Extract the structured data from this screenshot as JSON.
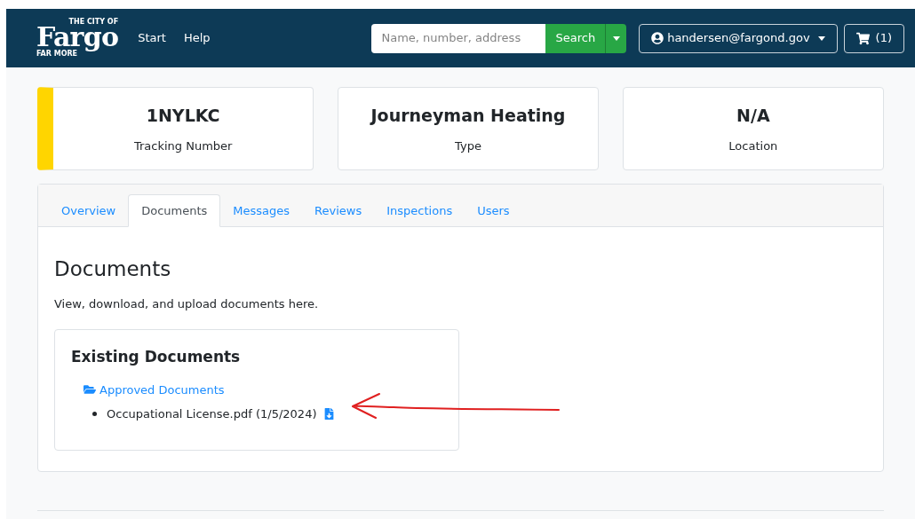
{
  "header": {
    "logo": {
      "top": "THE CITY OF",
      "name": "Fargo",
      "bottom": "FAR MORE"
    },
    "nav": [
      "Start",
      "Help"
    ],
    "search": {
      "placeholder": "Name, number, address",
      "button": "Search"
    },
    "user": "handersen@fargond.gov",
    "cart": "(1)"
  },
  "summary_cards": [
    {
      "value": "1NYLKC",
      "label": "Tracking Number",
      "color": "#ffd500"
    },
    {
      "value": "Journeyman Heating",
      "label": "Type"
    },
    {
      "value": "N/A",
      "label": "Location"
    }
  ],
  "tabs": [
    {
      "label": "Overview",
      "selected": false
    },
    {
      "label": "Documents",
      "selected": true
    },
    {
      "label": "Messages",
      "selected": false
    },
    {
      "label": "Reviews",
      "selected": false
    },
    {
      "label": "Inspections",
      "selected": false
    },
    {
      "label": "Users",
      "selected": false
    }
  ],
  "documents": {
    "title": "Documents",
    "description": "View, download, and upload documents here.",
    "panel_title": "Existing Documents",
    "folders": [
      {
        "name": "Approved Documents",
        "files": [
          "Occupational License.pdf (1/5/2024)"
        ]
      }
    ]
  }
}
